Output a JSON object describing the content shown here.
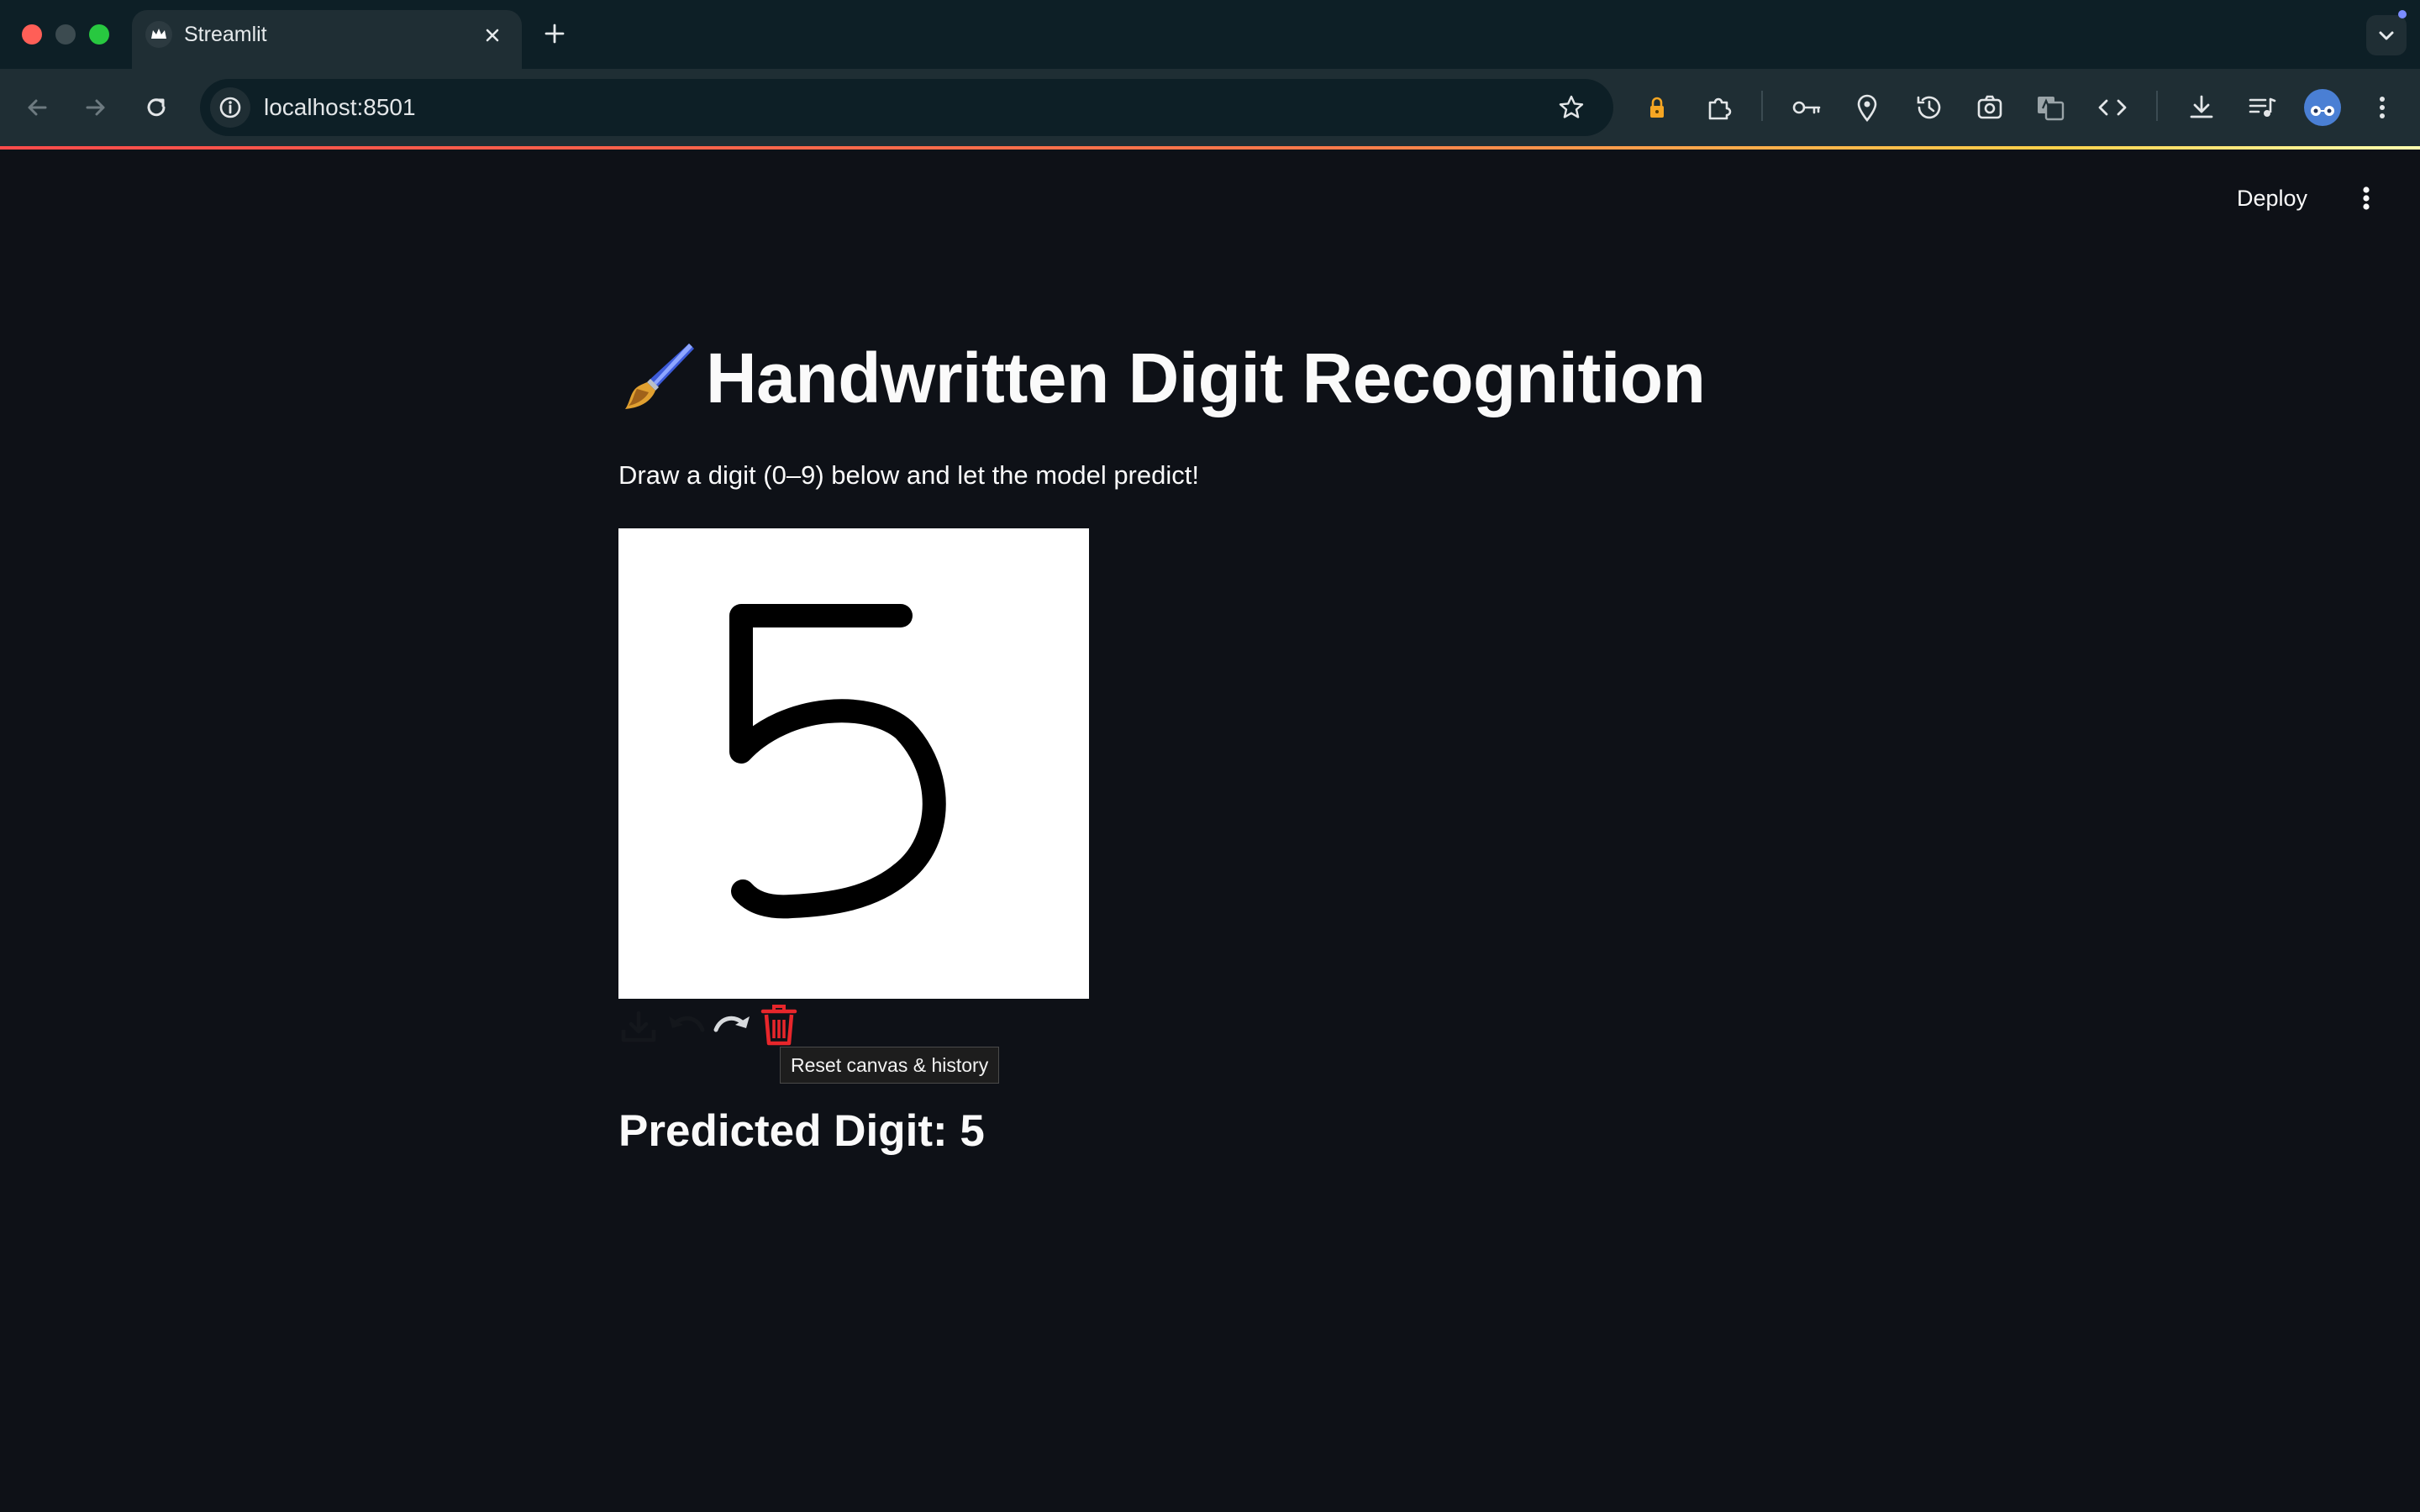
{
  "browser": {
    "tab_title": "Streamlit",
    "url": "localhost:8501",
    "colors": {
      "close": "#ff5f57",
      "minimize_inactive": "#3c4b50",
      "maximize": "#28c840"
    },
    "icons": [
      "streamlit-favicon-icon",
      "tab-close-icon",
      "new-tab-icon",
      "tab-search-icon",
      "back-icon",
      "forward-icon",
      "reload-icon",
      "site-info-icon",
      "bookmark-star-icon",
      "lock-extension-icon",
      "extensions-icon",
      "password-key-icon",
      "location-icon",
      "history-icon",
      "screenshot-icon",
      "translate-icon",
      "devtools-code-icon",
      "download-icon",
      "media-controls-icon",
      "profile-avatar-icon",
      "browser-menu-icon"
    ]
  },
  "app": {
    "deploy_label": "Deploy",
    "title_emoji": "🖌️",
    "title": "Handwritten Digit Recognition",
    "subtitle": "Draw a digit (0–9) below and let the model predict!",
    "canvas": {
      "background": "#ffffff",
      "stroke_color": "#000000",
      "drawn_digit": "5",
      "toolbar_icons": [
        "download-icon",
        "undo-icon",
        "redo-icon",
        "trash-icon"
      ],
      "tooltip": "Reset canvas & history"
    },
    "prediction": "Predicted Digit: 5",
    "accent": "#ff4b4b",
    "background": "#0e1117"
  }
}
